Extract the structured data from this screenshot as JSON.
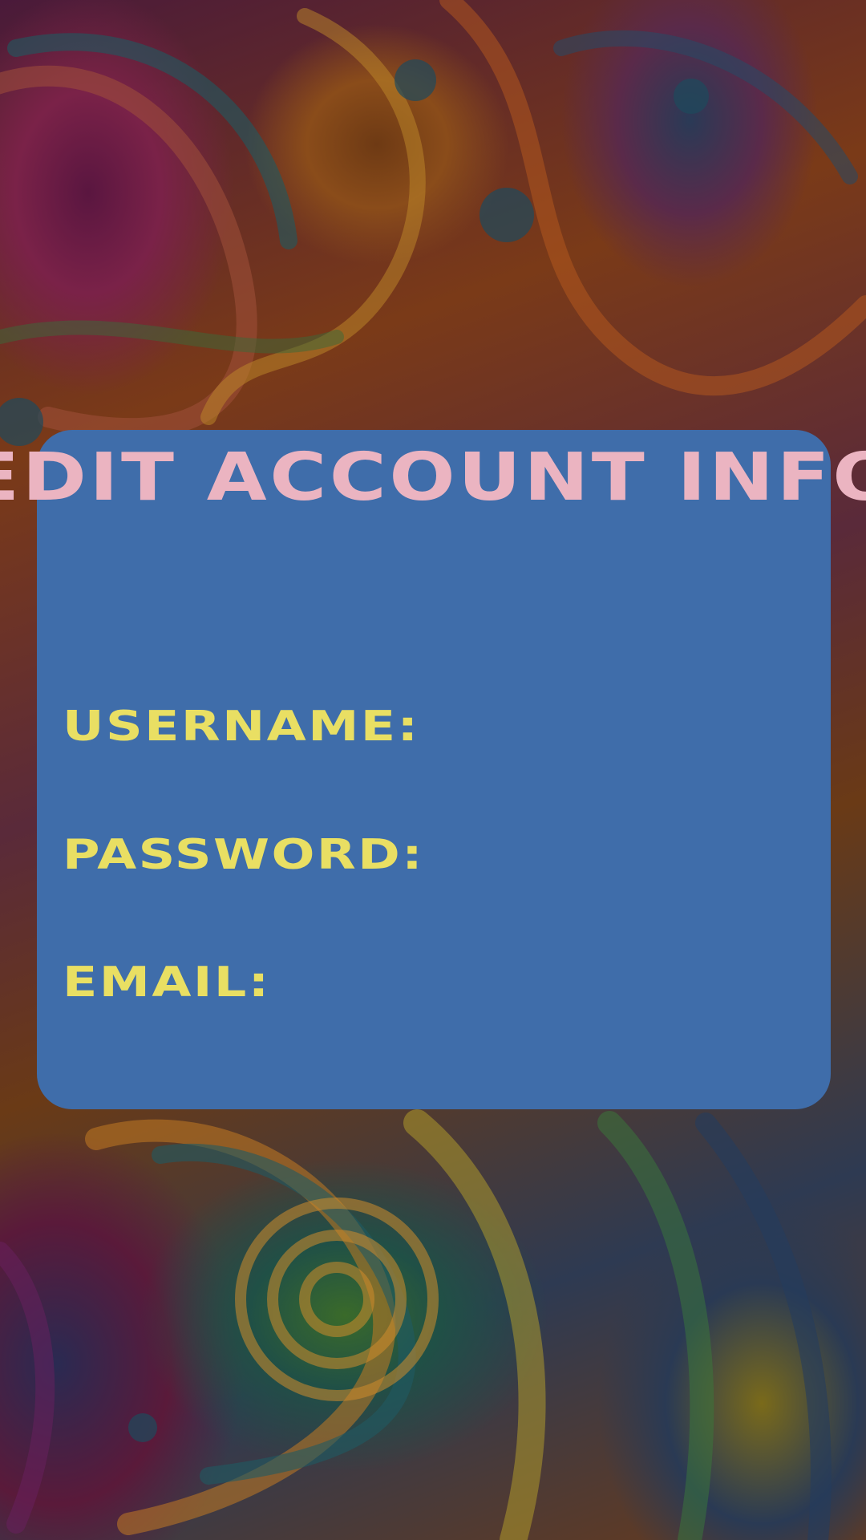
{
  "title": "EDIT ACCOUNT INFO",
  "fields": {
    "username_label": "USERNAME:",
    "password_label": "PASSWORD:",
    "email_label": "EMAIL:"
  },
  "colors": {
    "card_background": "#3f6daa",
    "title_text": "#ebb4c1",
    "label_text": "#e9df63"
  }
}
